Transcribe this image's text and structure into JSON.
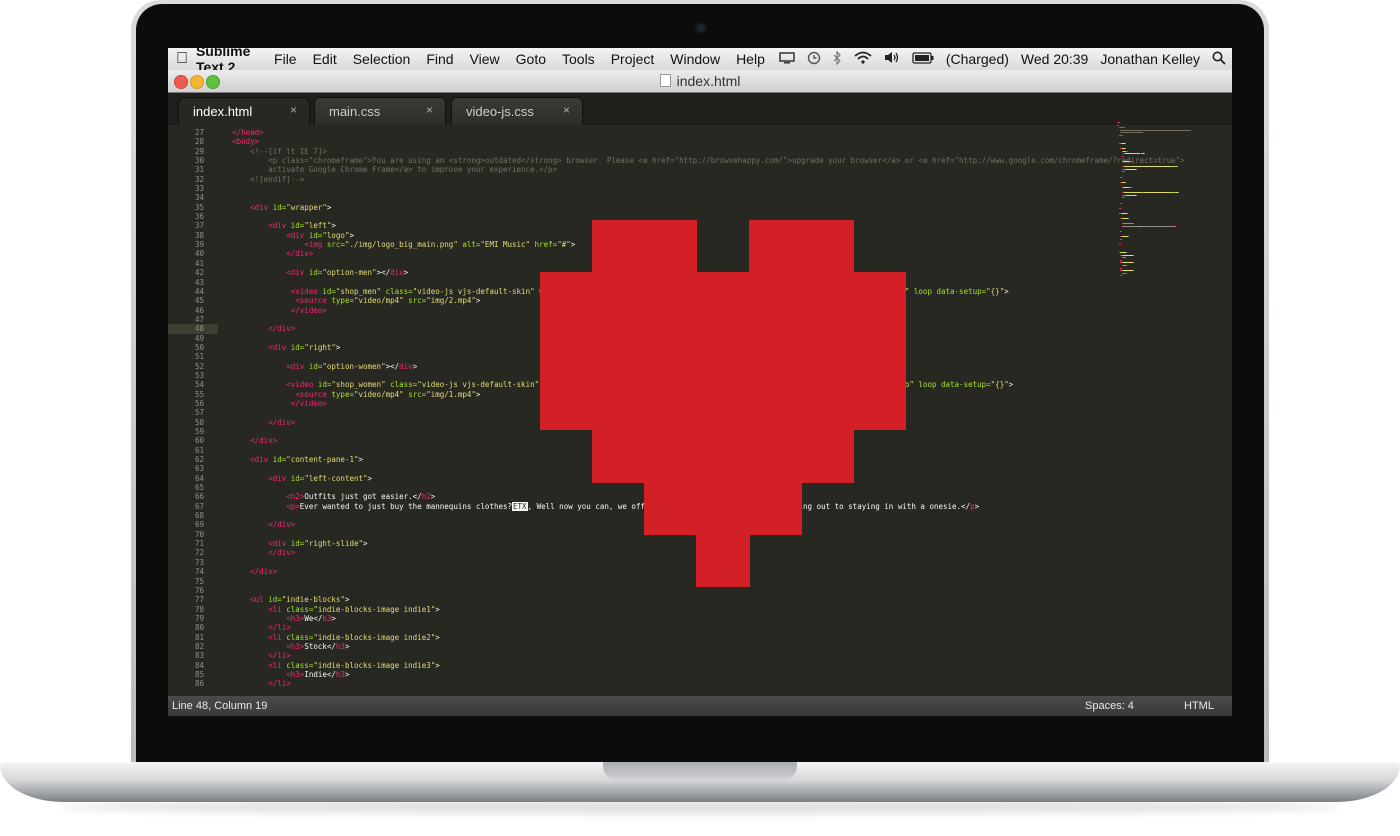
{
  "menubar": {
    "app_name": "Sublime Text 2",
    "menus": [
      "File",
      "Edit",
      "Selection",
      "Find",
      "View",
      "Goto",
      "Tools",
      "Project",
      "Window",
      "Help"
    ],
    "battery_status": "(Charged)",
    "clock": "Wed 20:39",
    "user": "Jonathan Kelley"
  },
  "window": {
    "title": "index.html"
  },
  "tabs": [
    {
      "label": "index.html",
      "close": "×"
    },
    {
      "label": "main.css",
      "close": "×"
    },
    {
      "label": "video-js.css",
      "close": "×"
    }
  ],
  "editor": {
    "line_numbers": [
      "27",
      "28",
      "29",
      "30",
      "31",
      "32",
      "33",
      "34",
      "35",
      "36",
      "37",
      "38",
      "39",
      "40",
      "41",
      "42",
      "43",
      "44",
      "45",
      "46",
      "47",
      "48",
      "49",
      "50",
      "51",
      "52",
      "53",
      "54",
      "55",
      "56",
      "57",
      "58",
      "59",
      "60",
      "61",
      "62",
      "63",
      "64",
      "65",
      "66",
      "67",
      "68",
      "69",
      "70",
      "71",
      "72",
      "73",
      "74",
      "75",
      "76",
      "77",
      "78",
      "79",
      "80",
      "81",
      "82",
      "83",
      "84",
      "85",
      "86"
    ],
    "highlighted_line": "48",
    "code_lines": [
      [
        [
          "",
          "    "
        ],
        [
          "tg",
          "</head>"
        ]
      ],
      [
        [
          "",
          "    "
        ],
        [
          "tg",
          "<body>"
        ]
      ],
      [
        [
          "",
          "        "
        ],
        [
          "cm",
          "<!--[if lt IE 7]>"
        ]
      ],
      [
        [
          "",
          "            "
        ],
        [
          "cm",
          "<p class=\"chromeframe\">You are using an <strong>outdated</strong> browser. Please <a href=\"http://browsehappy.com/\">upgrade your browser</a> or <a href=\"http://www.google.com/chromeframe/?redirect=true\">"
        ]
      ],
      [
        [
          "",
          "            "
        ],
        [
          "cm",
          "activate Google Chrome Frame</a> to improve your experience.</p>"
        ]
      ],
      [
        [
          "",
          "        "
        ],
        [
          "cm",
          "<![endif]-->"
        ]
      ],
      [
        [
          "",
          ""
        ]
      ],
      [
        [
          "",
          ""
        ]
      ],
      [
        [
          "",
          "        "
        ],
        [
          "tg",
          "<div "
        ],
        [
          "at",
          "id="
        ],
        [
          "st",
          "\"wrapper\""
        ],
        [
          "",
          ">"
        ]
      ],
      [
        [
          "",
          ""
        ]
      ],
      [
        [
          "",
          "            "
        ],
        [
          "tg",
          "<div "
        ],
        [
          "at",
          "id="
        ],
        [
          "st",
          "\"left\""
        ],
        [
          "",
          ">"
        ]
      ],
      [
        [
          "",
          "                "
        ],
        [
          "tg",
          "<div "
        ],
        [
          "at",
          "id="
        ],
        [
          "st",
          "\"logo\""
        ],
        [
          "",
          ">"
        ]
      ],
      [
        [
          "",
          "                    "
        ],
        [
          "tg",
          "<img "
        ],
        [
          "at",
          "src="
        ],
        [
          "st",
          "\"./img/logo_big_main.png\""
        ],
        [
          "at",
          " alt="
        ],
        [
          "st",
          "\"EMI Music\""
        ],
        [
          "at",
          " href="
        ],
        [
          "st",
          "\"#\""
        ],
        [
          "",
          ">"
        ]
      ],
      [
        [
          "",
          "                "
        ],
        [
          "tg",
          "</div>"
        ]
      ],
      [
        [
          "",
          ""
        ]
      ],
      [
        [
          "",
          "                "
        ],
        [
          "tg",
          "<div "
        ],
        [
          "at",
          "id="
        ],
        [
          "st",
          "\"option-men\""
        ],
        [
          "",
          "></"
        ],
        [
          "tg",
          "div"
        ],
        [
          "",
          ">"
        ]
      ],
      [
        [
          "",
          ""
        ]
      ],
      [
        [
          "",
          "                 "
        ],
        [
          "tg",
          "<video "
        ],
        [
          "at",
          "id="
        ],
        [
          "st",
          "\"shop_men\""
        ],
        [
          "at",
          " class="
        ],
        [
          "st",
          "\"video-js vjs-default-skin\""
        ],
        [
          "at",
          " width="
        ],
        [
          "st",
          "\"640\" height=\"264\" poster=\"img/1.jpg\" controls autoplay muted preload=\"auto\""
        ],
        [
          "at",
          " loop data-setup="
        ],
        [
          "st",
          "\"{}\""
        ],
        [
          "",
          ">"
        ]
      ],
      [
        [
          "",
          "                  "
        ],
        [
          "tg",
          "<source "
        ],
        [
          "at",
          "type="
        ],
        [
          "st",
          "\"video/mp4\""
        ],
        [
          "at",
          " src="
        ],
        [
          "st",
          "\"img/2.mp4\""
        ],
        [
          "",
          ">"
        ]
      ],
      [
        [
          "",
          "                 "
        ],
        [
          "tg",
          "</video>"
        ]
      ],
      [
        [
          "",
          ""
        ]
      ],
      [
        [
          "",
          "            "
        ],
        [
          "tg",
          "</div>"
        ]
      ],
      [
        [
          "",
          ""
        ]
      ],
      [
        [
          "",
          "            "
        ],
        [
          "tg",
          "<div "
        ],
        [
          "at",
          "id="
        ],
        [
          "st",
          "\"right\""
        ],
        [
          "",
          ">"
        ]
      ],
      [
        [
          "",
          ""
        ]
      ],
      [
        [
          "",
          "                "
        ],
        [
          "tg",
          "<div "
        ],
        [
          "at",
          "id="
        ],
        [
          "st",
          "\"option-women\""
        ],
        [
          "",
          "></"
        ],
        [
          "tg",
          "div"
        ],
        [
          "",
          ">"
        ]
      ],
      [
        [
          "",
          ""
        ]
      ],
      [
        [
          "",
          "                "
        ],
        [
          "tg",
          "<video "
        ],
        [
          "at",
          "id="
        ],
        [
          "st",
          "\"shop_women\""
        ],
        [
          "at",
          " class="
        ],
        [
          "st",
          "\"video-js vjs-default-skin\""
        ],
        [
          "at",
          " width="
        ],
        [
          "st",
          "\"640\" height=\"264\" poster=\"img/2.jpg\" controls autoplay muted preload=\"auto\""
        ],
        [
          "at",
          " loop data-setup="
        ],
        [
          "st",
          "\"{}\""
        ],
        [
          "",
          ">"
        ]
      ],
      [
        [
          "",
          "                  "
        ],
        [
          "tg",
          "<source "
        ],
        [
          "at",
          "type="
        ],
        [
          "st",
          "\"video/mp4\""
        ],
        [
          "at",
          " src="
        ],
        [
          "st",
          "\"img/1.mp4\""
        ],
        [
          "",
          ">"
        ]
      ],
      [
        [
          "",
          "                 "
        ],
        [
          "tg",
          "</video>"
        ]
      ],
      [
        [
          "",
          ""
        ]
      ],
      [
        [
          "",
          "            "
        ],
        [
          "tg",
          "</div>"
        ]
      ],
      [
        [
          "",
          ""
        ]
      ],
      [
        [
          "",
          "        "
        ],
        [
          "tg",
          "</div>"
        ]
      ],
      [
        [
          "",
          ""
        ]
      ],
      [
        [
          "",
          "        "
        ],
        [
          "tg",
          "<div "
        ],
        [
          "at",
          "id="
        ],
        [
          "st",
          "\"content-pane-1\""
        ],
        [
          "",
          ">"
        ]
      ],
      [
        [
          "",
          ""
        ]
      ],
      [
        [
          "",
          "            "
        ],
        [
          "tg",
          "<div "
        ],
        [
          "at",
          "id="
        ],
        [
          "st",
          "\"left-content\""
        ],
        [
          "",
          ">"
        ]
      ],
      [
        [
          "",
          ""
        ]
      ],
      [
        [
          "",
          "                "
        ],
        [
          "tg",
          "<h2>"
        ],
        [
          "",
          "Outfits just got easier.</"
        ],
        [
          "tg",
          "h2"
        ],
        [
          "",
          ">"
        ]
      ],
      [
        [
          "",
          "                "
        ],
        [
          "tg",
          "<p>"
        ],
        [
          "",
          "Ever wanted to just buy the mannequins clothes?"
        ],
        [
          "etx",
          "ETX"
        ],
        [
          "",
          ", Well now you can, we offer a wide range of outfits from going out to staying in with a onesie.</"
        ],
        [
          "tg",
          "p"
        ],
        [
          "",
          ">"
        ]
      ],
      [
        [
          "",
          ""
        ]
      ],
      [
        [
          "",
          "            "
        ],
        [
          "tg",
          "</div>"
        ]
      ],
      [
        [
          "",
          ""
        ]
      ],
      [
        [
          "",
          "            "
        ],
        [
          "tg",
          "<div "
        ],
        [
          "at",
          "id="
        ],
        [
          "st",
          "\"right-slide\""
        ],
        [
          "",
          ">"
        ]
      ],
      [
        [
          "",
          "            "
        ],
        [
          "tg",
          "</div>"
        ]
      ],
      [
        [
          "",
          ""
        ]
      ],
      [
        [
          "",
          "        "
        ],
        [
          "tg",
          "</div>"
        ]
      ],
      [
        [
          "",
          ""
        ]
      ],
      [
        [
          "",
          ""
        ]
      ],
      [
        [
          "",
          "        "
        ],
        [
          "tg",
          "<ul "
        ],
        [
          "at",
          "id="
        ],
        [
          "st",
          "\"indie-blocks\""
        ],
        [
          "",
          ">"
        ]
      ],
      [
        [
          "",
          "            "
        ],
        [
          "tg",
          "<li "
        ],
        [
          "at",
          "class="
        ],
        [
          "st",
          "\"indie-blocks-image indie1\""
        ],
        [
          "",
          ">"
        ]
      ],
      [
        [
          "",
          "                "
        ],
        [
          "tg",
          "<h3>"
        ],
        [
          "",
          "We</"
        ],
        [
          "tg",
          "h3"
        ],
        [
          "",
          ">"
        ]
      ],
      [
        [
          "",
          "            "
        ],
        [
          "tg",
          "</li>"
        ]
      ],
      [
        [
          "",
          "            "
        ],
        [
          "tg",
          "<li "
        ],
        [
          "at",
          "class="
        ],
        [
          "st",
          "\"indie-blocks-image indie2\""
        ],
        [
          "",
          ">"
        ]
      ],
      [
        [
          "",
          "                "
        ],
        [
          "tg",
          "<h3>"
        ],
        [
          "",
          "Stock</"
        ],
        [
          "tg",
          "h3"
        ],
        [
          "",
          ">"
        ]
      ],
      [
        [
          "",
          "            "
        ],
        [
          "tg",
          "</li>"
        ]
      ],
      [
        [
          "",
          "            "
        ],
        [
          "tg",
          "<li "
        ],
        [
          "at",
          "class="
        ],
        [
          "st",
          "\"indie-blocks-image indie3\""
        ],
        [
          "",
          ">"
        ]
      ],
      [
        [
          "",
          "                "
        ],
        [
          "tg",
          "<h3>"
        ],
        [
          "",
          "Indie</"
        ],
        [
          "tg",
          "h3"
        ],
        [
          "",
          ">"
        ]
      ],
      [
        [
          "",
          "            "
        ],
        [
          "tg",
          "</li>"
        ]
      ]
    ]
  },
  "statusbar": {
    "position": "Line 48, Column 19",
    "indentation": "Spaces: 4",
    "syntax": "HTML"
  },
  "icons": {
    "apple": "apple-icon",
    "display": "display-icon",
    "time_machine": "time-machine-icon",
    "bluetooth": "bluetooth-icon",
    "wifi": "wifi-icon",
    "volume": "volume-icon",
    "battery": "battery-icon",
    "search": "spotlight-search-icon",
    "heart": "pixel-heart-icon"
  },
  "colors": {
    "heart": "#d31f26",
    "editor_bg": "#272822",
    "tag": "#f92672",
    "attribute": "#a6e22e",
    "string": "#e6db74",
    "comment": "#75715e"
  }
}
